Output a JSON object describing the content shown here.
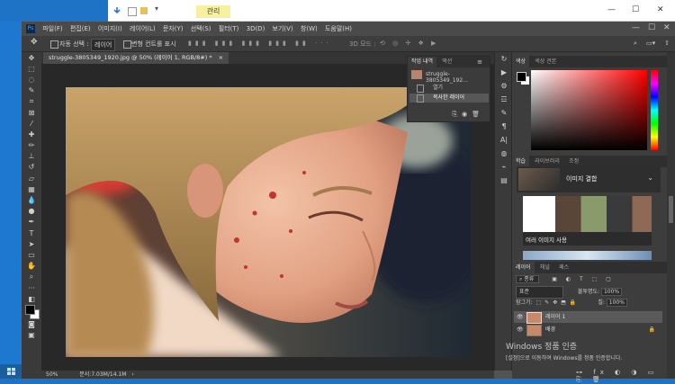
{
  "explorer": {
    "manage_tab": "관리",
    "minimize": "—",
    "maximize": "☐",
    "close": "✕"
  },
  "ps": {
    "logo": "Ps",
    "menu": [
      "파일(F)",
      "편집(E)",
      "이미지(I)",
      "레이어(L)",
      "문자(Y)",
      "선택(S)",
      "필터(T)",
      "3D(D)",
      "보기(V)",
      "창(W)",
      "도움말(H)"
    ],
    "options": {
      "auto_select": "자동 선택 :",
      "target": "레이어",
      "transform": "변형 컨트롤 표시",
      "mode3d": "3D 모드 :"
    },
    "doc_tab": "struggle-3805349_1920.jpg @ 50% (레이어 1, RGB/8#) *",
    "tab_close": "×",
    "status_zoom": "50%",
    "status_doc": "문서:7.03M/14.1M"
  },
  "history": {
    "tabs": [
      "작업 내역",
      "액션"
    ],
    "snapshot": "struggle-3805349_192...",
    "items": [
      "열기",
      "복사한 레이어"
    ]
  },
  "colors_panel": {
    "tabs": [
      "색상",
      "색상 견본"
    ]
  },
  "learn_panel": {
    "tabs": [
      "학습",
      "라이브러리",
      "조정"
    ],
    "card_title": "이미지 결합",
    "card_subtitle": "여러 이미지 사용"
  },
  "layers_panel": {
    "tabs": [
      "레이어",
      "채널",
      "패스"
    ],
    "filter_kind": "종류",
    "blend_mode": "표준",
    "opacity_label": "불투명도:",
    "opacity_value": "100%",
    "lock_label": "잠그기:",
    "fill_label": "칠:",
    "fill_value": "100%",
    "layers": [
      {
        "name": "레이어 1",
        "selected": true
      },
      {
        "name": "배경",
        "selected": false
      }
    ]
  },
  "watermark": {
    "title": "Windows 정품 인증",
    "subtitle": "[설정]으로 이동하여 Windows를 정품 인증합니다."
  }
}
